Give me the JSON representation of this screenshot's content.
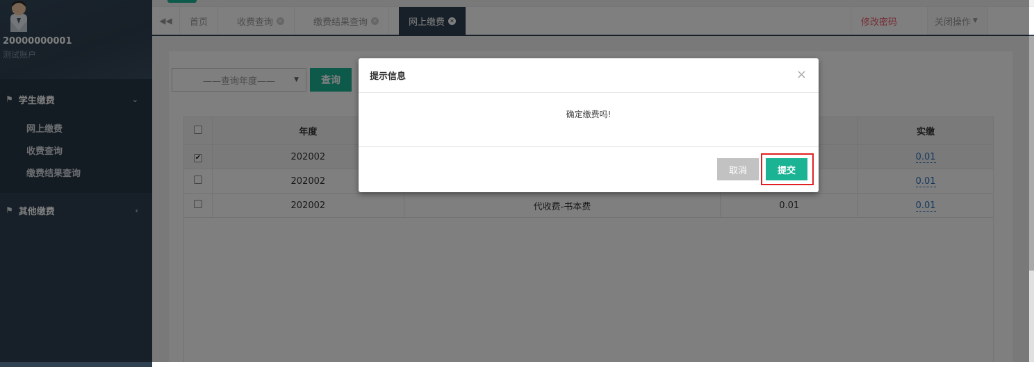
{
  "user": {
    "account_id": "20000000001",
    "account_name": "测试账户"
  },
  "sidebar": {
    "groups": [
      {
        "label": "学生缴费",
        "items": [
          "网上缴费",
          "收费查询",
          "缴费结果查询"
        ]
      },
      {
        "label": "其他缴费"
      }
    ]
  },
  "tabs": {
    "items": [
      "首页",
      "收费查询",
      "缴费结果查询",
      "网上缴费"
    ],
    "active": "网上缴费",
    "change_password": "修改密码",
    "close_ops": "关闭操作"
  },
  "filter": {
    "year_placeholder": "——查询年度——",
    "query_label": "查询"
  },
  "table": {
    "col_year": "年度",
    "col_actual": "实缴",
    "rows": [
      {
        "checked": true,
        "year": "202002",
        "item": "",
        "amount": "",
        "actual": "0.01"
      },
      {
        "checked": false,
        "year": "202002",
        "item": "",
        "amount": "",
        "actual": "0.01"
      },
      {
        "checked": false,
        "year": "202002",
        "item": "代收费-书本费",
        "amount": "0.01",
        "actual": "0.01"
      }
    ]
  },
  "dialog": {
    "title": "提示信息",
    "message": "确定缴费吗!",
    "cancel_label": "取消",
    "submit_label": "提交",
    "close_symbol": "×"
  },
  "colors": {
    "sidebar_bg": "#2f4050",
    "accent": "#1ab394",
    "danger": "#ed5565",
    "highlight": "#e02020"
  },
  "icons": [
    "user-avatar-icon",
    "home-icon",
    "chevron-down-icon",
    "chevron-left-icon",
    "double-chevron-left-icon",
    "close-circle-icon",
    "caret-down-icon",
    "checkbox-icon"
  ]
}
